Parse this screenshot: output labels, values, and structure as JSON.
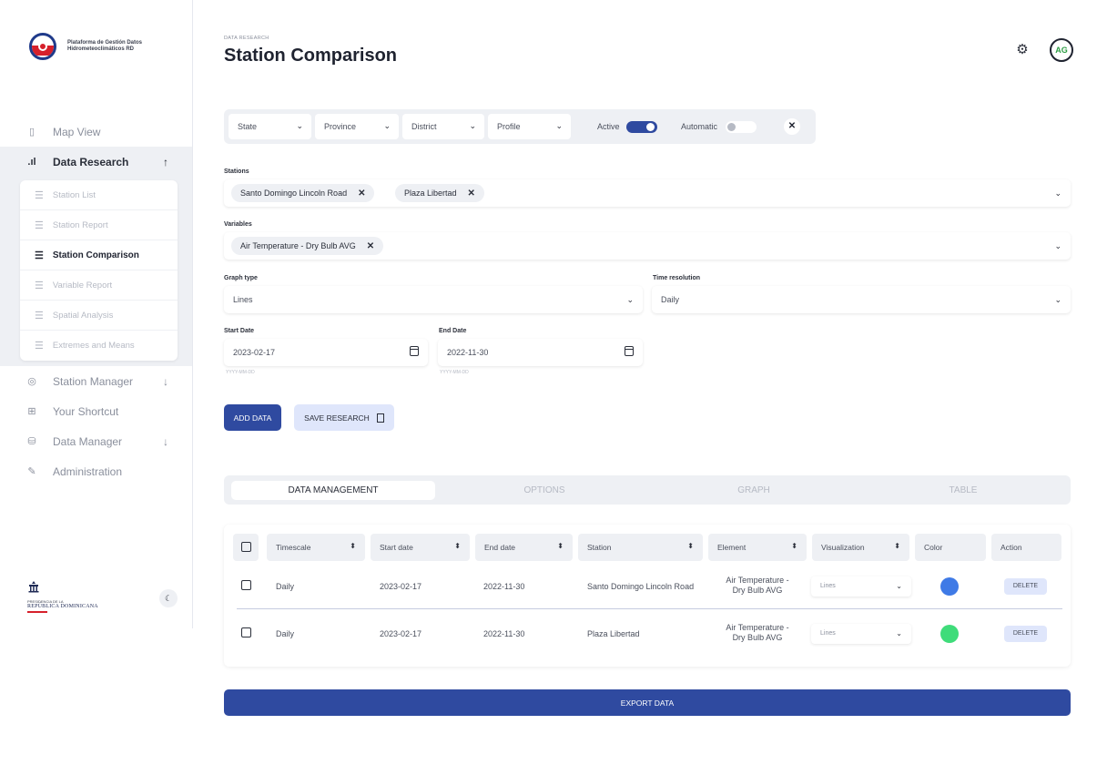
{
  "brand": {
    "title_line1": "Plataforma de Gestión Datos",
    "title_line2": "Hidrometeoclimáticos RD"
  },
  "sidebar": {
    "items": [
      {
        "label": "Map View",
        "icon": "map-icon"
      },
      {
        "label": "Data Research",
        "icon": "bar-chart-icon",
        "expanded": true
      },
      {
        "label": "Station Manager",
        "icon": "location-pin-icon"
      },
      {
        "label": "Your Shortcut",
        "icon": "grid-icon"
      },
      {
        "label": "Data Manager",
        "icon": "database-icon"
      },
      {
        "label": "Administration",
        "icon": "wrench-icon"
      }
    ],
    "subitems": [
      {
        "label": "Station List"
      },
      {
        "label": "Station Report"
      },
      {
        "label": "Station Comparison",
        "active": true
      },
      {
        "label": "Variable Report"
      },
      {
        "label": "Spatial Analysis"
      },
      {
        "label": "Extremes and Means"
      }
    ],
    "gov_line1": "PRESIDENCIA DE LA",
    "gov_line2": "REPÚBLICA DOMINICANA"
  },
  "header": {
    "breadcrumb": "DATA RESEARCH",
    "title": "Station Comparison",
    "avatar_initials": "AG"
  },
  "filters": {
    "selects": [
      "State",
      "Province",
      "District",
      "Profile"
    ],
    "active_label": "Active",
    "active_on": true,
    "automatic_label": "Automatic",
    "automatic_on": false
  },
  "form": {
    "stations_label": "Stations",
    "stations": [
      "Santo Domingo Lincoln Road",
      "Plaza Libertad"
    ],
    "variables_label": "Variables",
    "variables": [
      "Air Temperature - Dry Bulb AVG"
    ],
    "graph_type_label": "Graph type",
    "graph_type": "Lines",
    "time_resolution_label": "Time resolution",
    "time_resolution": "Daily",
    "start_date_label": "Start Date",
    "start_date": "2023-02-17",
    "end_date_label": "End Date",
    "end_date": "2022-11-30",
    "date_hint": "YYYY-MM-DD"
  },
  "actions": {
    "add": "ADD DATA",
    "save": "SAVE RESEARCH",
    "export": "EXPORT DATA"
  },
  "tabs": [
    "DATA MANAGEMENT",
    "OPTIONS",
    "GRAPH",
    "TABLE"
  ],
  "table": {
    "headers": [
      "Timescale",
      "Start date",
      "End date",
      "Station",
      "Element",
      "Visualization",
      "Color",
      "Action"
    ],
    "rows": [
      {
        "timescale": "Daily",
        "start": "2023-02-17",
        "end": "2022-11-30",
        "station": "Santo Domingo Lincoln Road",
        "element_l1": "Air Temperature -",
        "element_l2": "Dry Bulb AVG",
        "visualization": "Lines",
        "color": "#3f7ae6",
        "action": "DELETE"
      },
      {
        "timescale": "Daily",
        "start": "2023-02-17",
        "end": "2022-11-30",
        "station": "Plaza Libertad",
        "element_l1": "Air Temperature -",
        "element_l2": "Dry Bulb AVG",
        "visualization": "Lines",
        "color": "#3fdc7a",
        "action": "DELETE"
      }
    ]
  }
}
